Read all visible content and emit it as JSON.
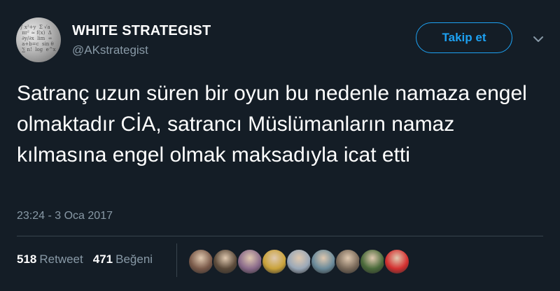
{
  "user": {
    "name": "WHITE STRATEGIST",
    "handle": "@AKstrategist",
    "avatar_icon": "formula-chalkboard-avatar"
  },
  "follow_button": {
    "label": "Takip et"
  },
  "menu": {
    "icon": "chevron-down-icon"
  },
  "tweet": {
    "text": "Satranç uzun süren bir oyun bu nedenle namaza engel olmaktadır CİA, satrancı Müslümanların namaz kılmasına engel olmak maksadıyla icat etti",
    "timestamp": "23:24 - 3 Oca 2017"
  },
  "stats": {
    "retweet_count": "518",
    "retweet_label": "Retweet",
    "like_count": "471",
    "like_label": "Beğeni"
  },
  "likers": [
    {
      "color": "#7a5a4a"
    },
    {
      "color": "#5b4a3a"
    },
    {
      "color": "#8a6a8a"
    },
    {
      "color": "#c9a23a"
    },
    {
      "color": "#9aa8b8"
    },
    {
      "color": "#6a8a9a"
    },
    {
      "color": "#7a6a5a"
    },
    {
      "color": "#4a6a3a"
    },
    {
      "color": "#d43030"
    }
  ],
  "colors": {
    "background": "#141d26",
    "accent": "#1da1f2",
    "secondary_text": "#8899a6"
  }
}
